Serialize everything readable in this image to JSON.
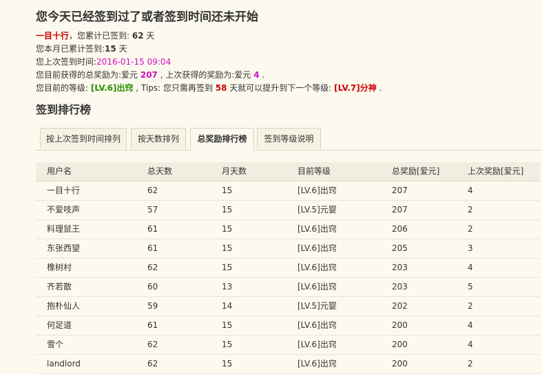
{
  "notice": "您今天已经签到过了或者签到时间还未开始",
  "info": {
    "line1": {
      "name": "一目十行",
      "text": "，您累计已签到: ",
      "value": "62",
      "unit": " 天"
    },
    "line2": {
      "text": "您本月已累计签到:",
      "value": "15",
      "unit": " 天"
    },
    "line3": {
      "text": "您上次签到时间:",
      "value": "2016-01-15 09:04"
    },
    "line4": {
      "text": "您目前获得的总奖励为:爱元 ",
      "value": "207",
      "text2": " , 上次获得的奖励为:爱元 ",
      "value2": "4",
      "end": " ."
    },
    "line5": {
      "text": "您目前的等级: ",
      "level": "[LV.6]出窍",
      "text2": " , Tips: 您只需再签到 ",
      "days": "58",
      "text3": " 天就可以提升到下一个等级: ",
      "next_level": "[LV.7]分神",
      "end": " ."
    }
  },
  "section_title": "签到排行榜",
  "tabs": [
    {
      "label": "按上次签到时间排列",
      "active": false
    },
    {
      "label": "按天数排列",
      "active": false
    },
    {
      "label": "总奖励排行榜",
      "active": true
    },
    {
      "label": "签到等级说明",
      "active": false
    }
  ],
  "table": {
    "headers": [
      "用户名",
      "总天数",
      "月天数",
      "目前等级",
      "总奖励[爱元]",
      "上次奖励[爱元]"
    ],
    "rows": [
      [
        "一目十行",
        "62",
        "15",
        "[LV.6]出窍",
        "207",
        "4"
      ],
      [
        "不爱吱声",
        "57",
        "15",
        "[LV.5]元婴",
        "207",
        "2"
      ],
      [
        "料理鼠王",
        "61",
        "15",
        "[LV.6]出窍",
        "206",
        "2"
      ],
      [
        "东张西望",
        "61",
        "15",
        "[LV.6]出窍",
        "205",
        "3"
      ],
      [
        "橡树村",
        "62",
        "15",
        "[LV.6]出窍",
        "203",
        "4"
      ],
      [
        "齐若散",
        "60",
        "13",
        "[LV.6]出窍",
        "203",
        "5"
      ],
      [
        "抱朴仙人",
        "59",
        "14",
        "[LV.5]元婴",
        "202",
        "2"
      ],
      [
        "何足道",
        "61",
        "15",
        "[LV.6]出窍",
        "200",
        "4"
      ],
      [
        "雪个",
        "62",
        "15",
        "[LV.6]出窍",
        "200",
        "4"
      ],
      [
        "landlord",
        "62",
        "15",
        "[LV.6]出窍",
        "200",
        "2"
      ]
    ]
  }
}
